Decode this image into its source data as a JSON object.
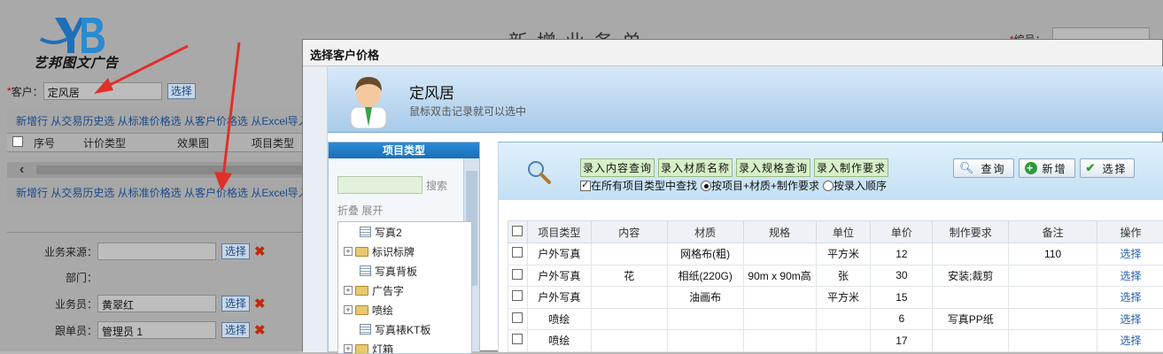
{
  "background_page": {
    "logo_text": "艺邦图文广告",
    "title": "新增业务单",
    "number_label": "编号：",
    "required_mark": "*",
    "customer_label": "客户：",
    "customer_value": "定风居",
    "select_label": "选择",
    "links_row": "新增行 从交易历史选 从标准价格选 从客户价格选 从Excel导入",
    "grid_headers": [
      "序号",
      "计价类型",
      "效果图",
      "项目类型"
    ],
    "scroll_left_glyph": "‹",
    "source_label": "业务来源：",
    "dept_label": "部门：",
    "salesman_label": "业务员：",
    "salesman_value": "黄翠红",
    "follower_label": "跟单员：",
    "follower_value": "管理员 1",
    "delete_glyph": "✖"
  },
  "modal": {
    "title": "选择客户价格",
    "customer_name": "定风居",
    "hint": "鼠标双击记录就可以选中",
    "type_panel": {
      "title": "项目类型",
      "search_label": "搜索",
      "fold_links": "折叠 展开",
      "tree": [
        {
          "label": "写真2",
          "kind": "leaf"
        },
        {
          "label": "标识标牌",
          "kind": "folder"
        },
        {
          "label": "写真背板",
          "kind": "leaf"
        },
        {
          "label": "广告字",
          "kind": "folder"
        },
        {
          "label": "喷绘",
          "kind": "folder"
        },
        {
          "label": "写真裱KT板",
          "kind": "leaf"
        },
        {
          "label": "灯箱",
          "kind": "folder"
        }
      ]
    },
    "query": {
      "chips": [
        "录入内容查询",
        "录入材质名称",
        "录入规格查询",
        "录入制作要求"
      ],
      "search_all_label": "在所有项目类型中查找",
      "radio_1": "按项目+材质+制作要求",
      "radio_2": "按录入顺序",
      "buttons": {
        "query": "查询",
        "add": "新增",
        "select": "选择"
      }
    },
    "grid": {
      "headers": [
        "项目类型",
        "内容",
        "材质",
        "规格",
        "单位",
        "单价",
        "制作要求",
        "备注",
        "操作"
      ],
      "rows": [
        [
          "户外写真",
          "",
          "网格布(粗)",
          "",
          "平方米",
          "12",
          "",
          "110",
          "选择"
        ],
        [
          "户外写真",
          "花",
          "相纸(220G)",
          "90m x 90m高",
          "张",
          "30",
          "安装;裁剪",
          "",
          "选择"
        ],
        [
          "户外写真",
          "",
          "油画布",
          "",
          "平方米",
          "15",
          "",
          "",
          "选择"
        ],
        [
          "喷绘",
          "",
          "",
          "",
          "",
          "6",
          "写真PP纸",
          "",
          "选择"
        ],
        [
          "喷绘",
          "",
          "",
          "",
          "",
          "17",
          "",
          "",
          "选择"
        ]
      ]
    }
  }
}
